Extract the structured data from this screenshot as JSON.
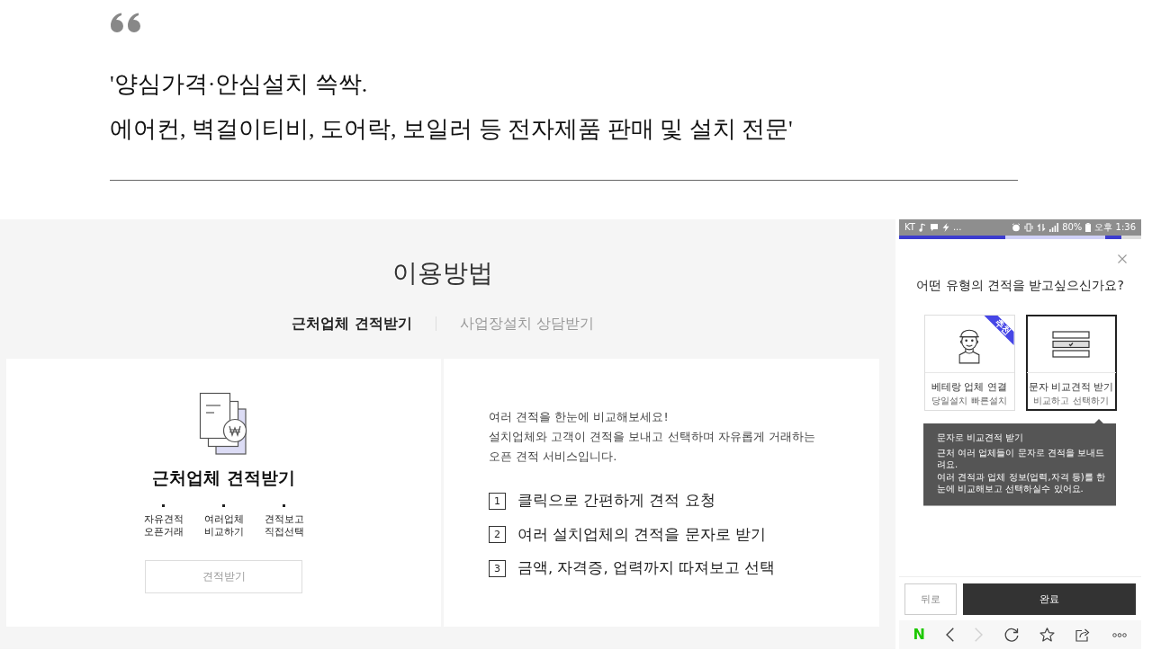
{
  "quote": {
    "lines": [
      "'양심가격·안심설치 쓱싹.",
      "에어컨, 벽걸이티비, 도어락, 보일러 등 전자제품 판매 및 설치 전문'"
    ]
  },
  "guide": {
    "title": "이용방법",
    "tabs": [
      {
        "label": "근처업체 견적받기",
        "selected": true
      },
      {
        "label": "사업장설치 상담받기",
        "selected": false
      }
    ],
    "card": {
      "title": "근처업체 견적받기",
      "features": [
        "자유견적 오픈거래",
        "여러업체 비교하기",
        "견적보고 직접선택"
      ],
      "button": "견적받기"
    },
    "intro": {
      "lines": [
        "여러 견적을 한눈에 비교해보세요!",
        "설치업체와 고객이 견적을 보내고 선택하며 자유롭게 거래하는",
        "오픈 견적 서비스입니다."
      ],
      "steps": [
        {
          "number": "1",
          "text": "클릭으로 간편하게 견적 요청"
        },
        {
          "number": "2",
          "text": "여러 설치업체의 견적을 문자로 받기"
        },
        {
          "number": "3",
          "text": "금액, 자격증, 업력까지 따져보고 선택"
        }
      ]
    }
  },
  "phone": {
    "status_bar": {
      "carrier": "KT",
      "more": "...",
      "battery": "80%",
      "time": "오후 1:36"
    },
    "progress": {
      "level": 0.44
    },
    "question": "어떤 유형의 견적을 받고싶으신가요?",
    "options": [
      {
        "kind": "worker",
        "title": "베테랑 업체 연결",
        "subtitle": "당일설치 빠른설치",
        "badge": "추천",
        "selected": false
      },
      {
        "kind": "list",
        "title": "문자 비교견적 받기",
        "subtitle": "비교하고 선택하기",
        "selected": true
      }
    ],
    "tooltip": {
      "title": "문자로 비교견적 받기",
      "lines": [
        "근처 여러 업체들이 문자로 견적을 보내드려요.",
        "여러 견적과 업체 정보(업력,자격 등)를 한눈에 비교해보고 선택하실수 있어요."
      ]
    },
    "buttons": {
      "back": "뒤로",
      "done": "완료"
    },
    "browser_bar": {
      "logo": "N",
      "buttons": [
        {
          "kind": "back",
          "disabled": false
        },
        {
          "kind": "forward",
          "disabled": true
        },
        {
          "kind": "reload",
          "disabled": false
        },
        {
          "kind": "bookmark",
          "disabled": false
        },
        {
          "kind": "share",
          "disabled": false
        },
        {
          "kind": "more",
          "disabled": false
        }
      ]
    }
  }
}
